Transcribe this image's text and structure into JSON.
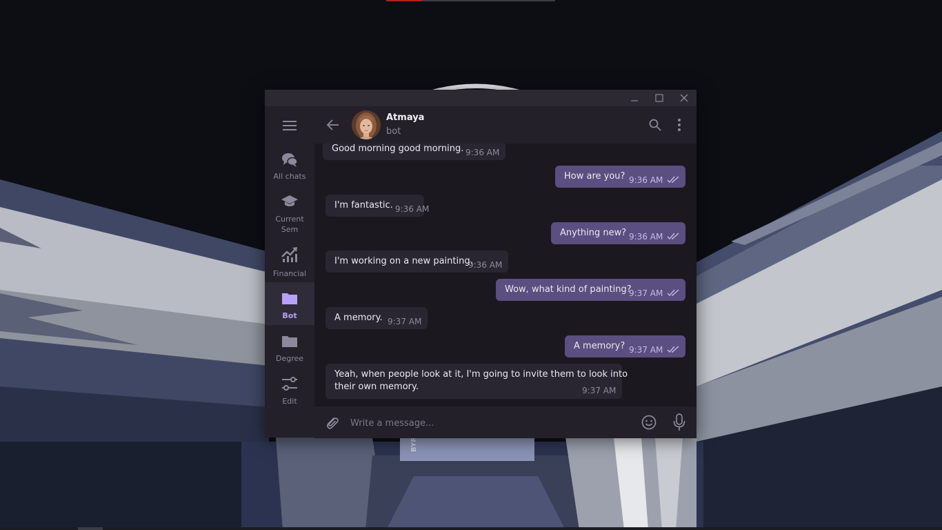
{
  "chat": {
    "name": "Atmaya",
    "status": "bot"
  },
  "window_controls": [
    "minimize",
    "maximize",
    "close"
  ],
  "sidebar": {
    "items": [
      {
        "label": "All chats",
        "icon": "chat-bubbles-icon"
      },
      {
        "label": "Current\nSem",
        "icon": "graduation-cap-icon"
      },
      {
        "label": "Financial",
        "icon": "trending-up-icon"
      },
      {
        "label": "Bot",
        "icon": "folder-icon",
        "active": true
      },
      {
        "label": "Degree",
        "icon": "folder-icon"
      },
      {
        "label": "Edit",
        "icon": "sliders-icon"
      }
    ]
  },
  "messages": [
    {
      "dir": "in",
      "text": "Good morning good morning.",
      "time": "9:36 AM"
    },
    {
      "dir": "out",
      "text": "How are you?",
      "time": "9:36 AM",
      "read": true
    },
    {
      "dir": "in",
      "text": "I'm fantastic.",
      "time": "9:36 AM"
    },
    {
      "dir": "out",
      "text": "Anything new?",
      "time": "9:36 AM",
      "read": true
    },
    {
      "dir": "in",
      "text": "I'm working on a new painting.",
      "time": "9:36 AM"
    },
    {
      "dir": "out",
      "text": "Wow, what kind of painting?",
      "time": "9:37 AM",
      "read": true
    },
    {
      "dir": "in",
      "text": "A memory.",
      "time": "9:37 AM"
    },
    {
      "dir": "out",
      "text": "A memory?",
      "time": "9:37 AM",
      "read": true
    },
    {
      "dir": "in",
      "text": "Yeah, when people look at it, I'm going to invite them to look into",
      "text2": "their own memory.",
      "time": "9:37 AM"
    }
  ],
  "composer": {
    "placeholder": "Write a message..."
  },
  "colors": {
    "accent": "#b8a2f5",
    "outgoing_bubble": "#5b4e80",
    "incoming_bubble": "#2a2631",
    "window_bg": "#1b1820",
    "sidebar_bg": "#232029"
  },
  "wallpaper_text": "BYR"
}
